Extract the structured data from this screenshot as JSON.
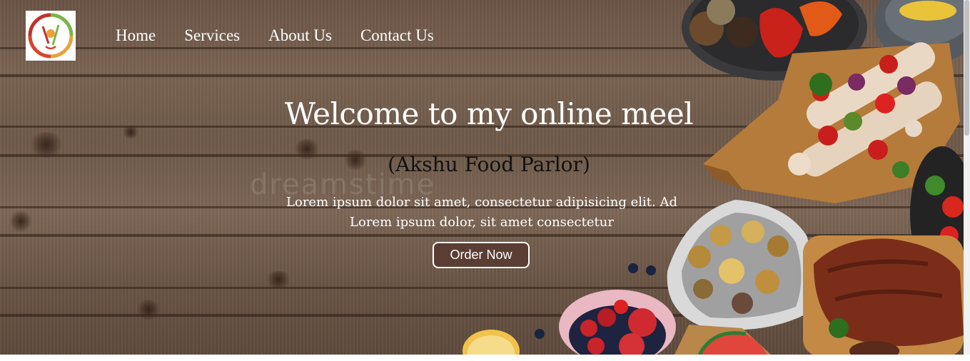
{
  "nav": {
    "items": [
      {
        "label": "Home"
      },
      {
        "label": "Services"
      },
      {
        "label": "About Us"
      },
      {
        "label": "Contact Us"
      }
    ]
  },
  "hero": {
    "title": "Welcome to my online meel",
    "subtitle": "(Akshu Food Parlor)",
    "description_line1": "Lorem ipsum dolor sit amet, consectetur adipisicing elit. Ad",
    "description_line2": "Lorem ipsum dolor, sit amet consectetur",
    "cta_label": "Order Now",
    "watermark": "dreamstime"
  },
  "colors": {
    "button_bg": "#5a3d33",
    "wood": "#6f5a4a",
    "text": "#ffffff"
  },
  "icons": [
    "logo-icon"
  ]
}
